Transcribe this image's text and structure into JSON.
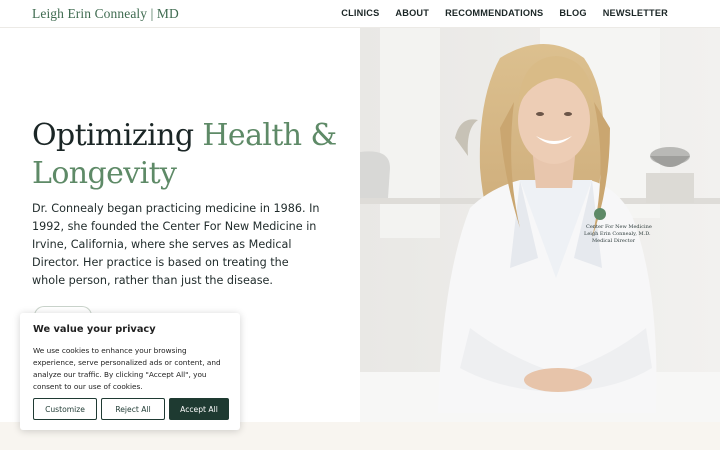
{
  "header": {
    "logo": "Leigh Erin Connealy | MD",
    "nav": [
      "CLINICS",
      "ABOUT",
      "RECOMMENDATIONS",
      "BLOG",
      "NEWSLETTER"
    ]
  },
  "hero": {
    "headline_main": "Optimizing ",
    "headline_accent": "Health & Longevity",
    "intro": "Dr. Connealy began practicing medicine in 1986. In 1992, she founded the Center For New Medicine in Irvine, California, where she serves as Medical Director. Her practice is based on treating the whole person, rather than just the disease.",
    "coat_embroidery": [
      "Center For New Medicine",
      "Leigh Erin Connealy, M.D.",
      "Medical Director"
    ]
  },
  "cookie_banner": {
    "title": "We value your privacy",
    "text": "We use cookies to enhance your browsing experience, serve personalized ads or content, and analyze our traffic. By clicking \"Accept All\", you consent to our use of cookies.",
    "customize_label": "Customize",
    "reject_label": "Reject All",
    "accept_label": "Accept All"
  },
  "colors": {
    "brand_green": "#5e8a67",
    "dark_green": "#1e3a31",
    "cream": "#f8f5f0"
  }
}
